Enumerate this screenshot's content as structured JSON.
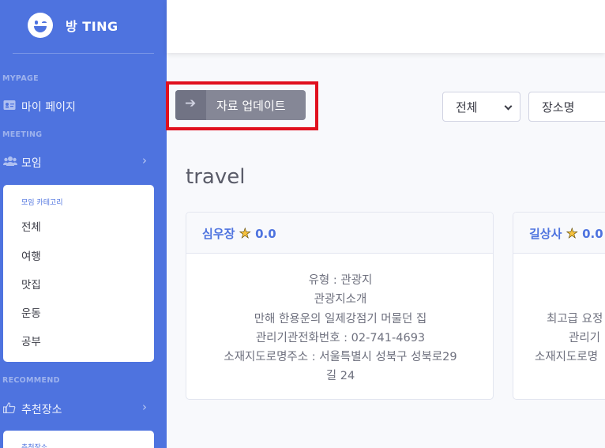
{
  "sidebar": {
    "brand": "방 TING",
    "headings": {
      "mypage": "MYPAGE",
      "meeting": "MEETING",
      "recommend": "RECOMMEND"
    },
    "items": {
      "mypage": "마이 페이지",
      "meeting": "모임",
      "recommend": "추천장소"
    },
    "meeting_collapse": {
      "header": "모임 카테고리",
      "items": [
        "전체",
        "여행",
        "맛집",
        "운동",
        "공부"
      ]
    },
    "recommend_collapse": {
      "header": "추천장소"
    }
  },
  "toolbar": {
    "update_label": "자료 업데이트",
    "filter_select": "전체",
    "search_placeholder": "장소명"
  },
  "section_title": "travel",
  "cards": [
    {
      "name": "심우장",
      "rating": "0.0",
      "lines": [
        "유형 : 관광지",
        "관광지소개",
        "만해 한용운의 일제강점기 머물던 집",
        "관리기관전화번호 : 02-741-4693",
        "소재지도로명주소 : 서울특별시 성북구 성북로29",
        "길 24"
      ]
    },
    {
      "name": "길상사",
      "rating": "0.0",
      "lines": [
        "",
        "",
        "최고급 요정",
        "관리기",
        "소재지도로명"
      ]
    }
  ],
  "colors": {
    "primary": "#4e73df",
    "secondary_button": "#858796",
    "highlight": "#e0101e",
    "star": "#f6c23e"
  }
}
